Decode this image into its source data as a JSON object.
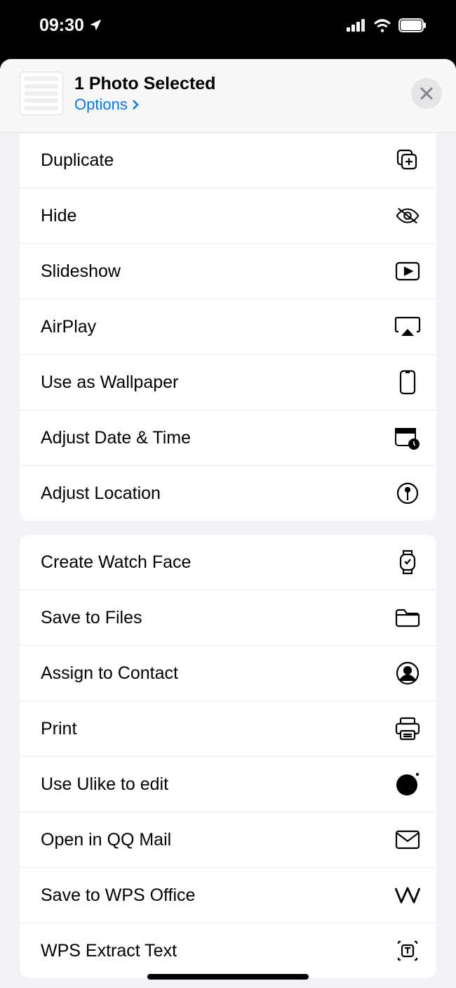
{
  "status": {
    "time": "09:30"
  },
  "header": {
    "title": "1 Photo Selected",
    "options": "Options"
  },
  "group1": {
    "duplicate": "Duplicate",
    "hide": "Hide",
    "slideshow": "Slideshow",
    "airplay": "AirPlay",
    "wallpaper": "Use as Wallpaper",
    "adjustdate": "Adjust Date & Time",
    "adjustloc": "Adjust Location"
  },
  "group2": {
    "watchface": "Create Watch Face",
    "savefiles": "Save to Files",
    "assigncontact": "Assign to Contact",
    "print": "Print",
    "ulike": "Use Ulike to edit",
    "qqmail": "Open in QQ Mail",
    "wpsoffice": "Save to WPS Office",
    "wpsextract": "WPS Extract Text"
  }
}
